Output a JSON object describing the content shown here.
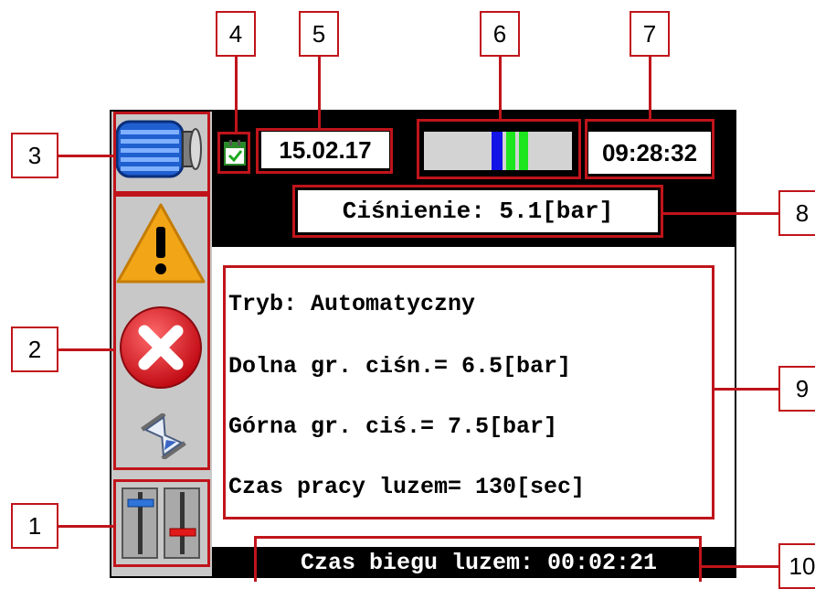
{
  "callouts": [
    "1",
    "2",
    "3",
    "4",
    "5",
    "6",
    "7",
    "8",
    "9",
    "10"
  ],
  "header": {
    "date": "15.02.17",
    "time": "09:28:32",
    "level_indicator": {
      "segments": [
        {
          "color": "#1414e6"
        },
        {
          "color": "#1ee61e"
        },
        {
          "color": "#1ee61e"
        }
      ]
    }
  },
  "pressure": {
    "text": "Ciśnienie: 5.1[bar]"
  },
  "params": {
    "mode": "Tryb: Automatyczny",
    "lower_limit": "Dolna gr. ciśn.= 6.5[bar]",
    "upper_limit": "Górna gr. ciś.= 7.5[bar]",
    "idle_time": "Czas pracy luzem= 130[sec]"
  },
  "footer": {
    "text": "Czas biegu luzem: 00:02:21"
  },
  "sidebar_icons": [
    "motor-icon",
    "warning-icon",
    "error-icon",
    "hourglass-icon",
    "sliders-icon"
  ],
  "colors": {
    "highlight": "#c0141b",
    "motor": "#1f5fd0",
    "warning": "#f2a516",
    "error": "#e3101b"
  }
}
